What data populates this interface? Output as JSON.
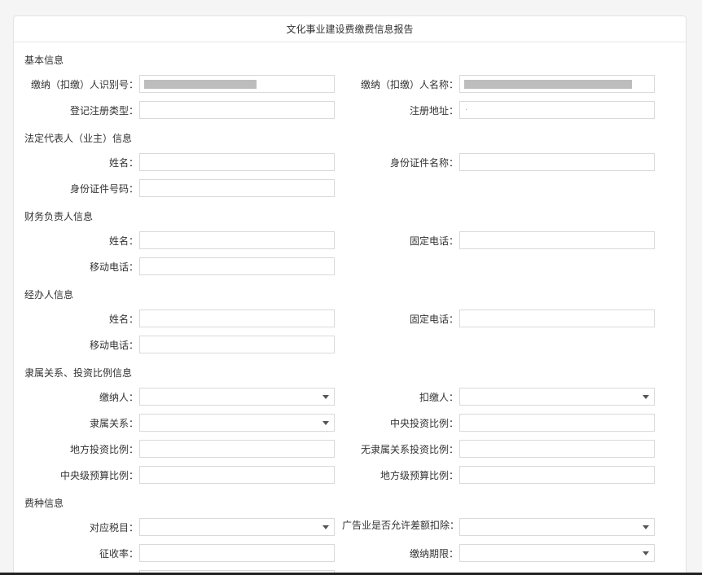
{
  "title": "文化事业建设费缴费信息报告",
  "sections": {
    "basic": "基本信息",
    "legal_rep": "法定代表人（业主）信息",
    "finance": "财务负责人信息",
    "agent": "经办人信息",
    "affiliation": "隶属关系、投资比例信息",
    "fee": "费种信息"
  },
  "labels": {
    "taxpayer_id": "缴纳（扣缴）人识别号：",
    "taxpayer_name": "缴纳（扣缴）人名称：",
    "reg_type": "登记注册类型：",
    "reg_address": "注册地址：",
    "lr_name": "姓名：",
    "lr_id_type": "身份证件名称：",
    "lr_id_no": "身份证件号码：",
    "fin_name": "姓名：",
    "fin_phone": "固定电话：",
    "fin_mobile": "移动电话：",
    "ag_name": "姓名：",
    "ag_phone": "固定电话：",
    "ag_mobile": "移动电话：",
    "payer": "缴纳人：",
    "withholder": "扣缴人：",
    "affiliation_rel": "隶属关系：",
    "central_ratio": "中央投资比例：",
    "local_ratio": "地方投资比例：",
    "no_affil_ratio": "无隶属关系投资比例：",
    "central_budget": "中央级预算比例：",
    "local_budget": "地方级预算比例：",
    "tax_item": "对应税目：",
    "ad_deduct": "广告业是否允许差额扣除：",
    "rate": "征收率：",
    "period": "缴纳期限："
  },
  "values": {
    "reg_address": "."
  }
}
